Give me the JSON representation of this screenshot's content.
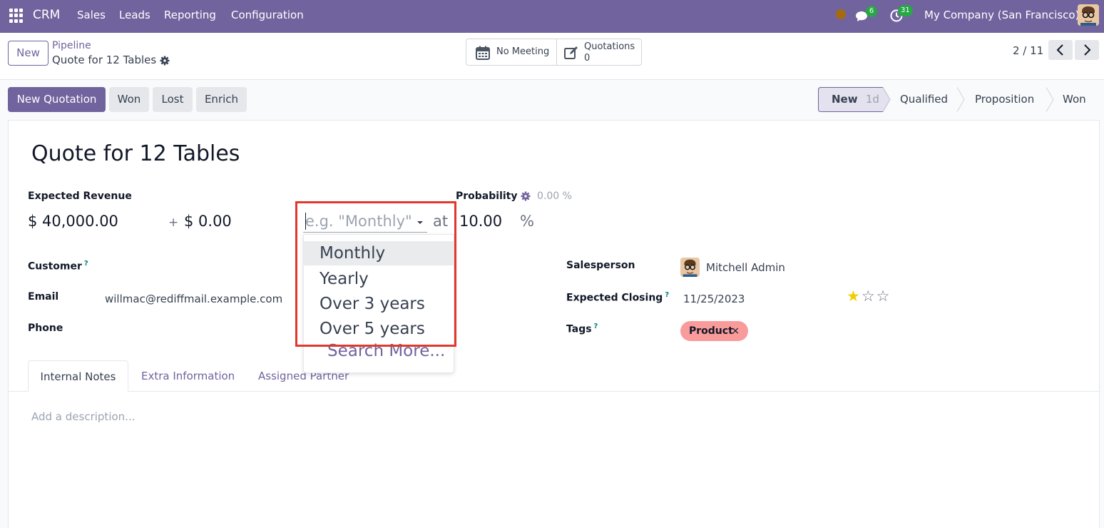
{
  "navbar": {
    "brand": "CRM",
    "menus": [
      "Sales",
      "Leads",
      "Reporting",
      "Configuration"
    ],
    "messages_count": "6",
    "activities_count": "31",
    "company": "My Company (San Francisco)"
  },
  "control": {
    "new_label": "New",
    "breadcrumb_parent": "Pipeline",
    "breadcrumb_current": "Quote for 12 Tables",
    "meeting_label": "No Meeting",
    "quotations_label": "Quotations",
    "quotations_count": "0",
    "pager": "2 / 11"
  },
  "actions": {
    "new_quotation": "New Quotation",
    "won": "Won",
    "lost": "Lost",
    "enrich": "Enrich"
  },
  "stages": [
    {
      "label": "New",
      "badge": "1d",
      "active": true
    },
    {
      "label": "Qualified"
    },
    {
      "label": "Proposition"
    },
    {
      "label": "Won"
    }
  ],
  "form": {
    "title": "Quote for 12 Tables",
    "expected_revenue_label": "Expected Revenue",
    "expected_revenue": "$ 40,000.00",
    "plus": "+",
    "recurring_revenue": "$ 0.00",
    "recurring_plan_placeholder": "e.g. \"Monthly\"",
    "at": "at",
    "probability_label": "Probability",
    "probability_auto": "0.00 %",
    "probability_value": "10.00",
    "percent": "%",
    "customer_label": "Customer",
    "help_mark": "?",
    "email_label": "Email",
    "email_value": "willmac@rediffmail.example.com",
    "phone_label": "Phone",
    "salesperson_label": "Salesperson",
    "salesperson_value": "Mitchell Admin",
    "expected_closing_label": "Expected Closing",
    "expected_closing_value": "11/25/2023",
    "priority": {
      "filled": 1,
      "total": 3
    },
    "tags_label": "Tags",
    "tag": "Product",
    "tag_remove": "×"
  },
  "tabs": {
    "internal_notes": "Internal Notes",
    "extra_information": "Extra Information",
    "assigned_partner": "Assigned Partner"
  },
  "description_placeholder": "Add a description...",
  "dropdown": {
    "items": [
      "Monthly",
      "Yearly",
      "Over 3 years",
      "Over 5 years"
    ],
    "search_more": "Search More..."
  },
  "colors": {
    "brand": "#71639e",
    "highlight_box": "#e1382c",
    "tag_bg": "#f99b9b",
    "star": "#f3cc00",
    "badge": "#28a745"
  }
}
